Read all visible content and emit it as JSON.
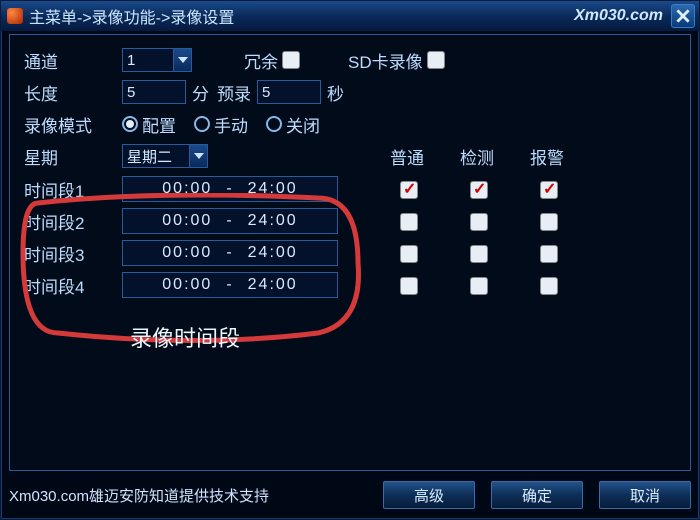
{
  "title": "主菜单->录像功能->录像设置",
  "watermark": "Xm030.com",
  "labels": {
    "channel": "通道",
    "redundancy": "冗余",
    "sdrecord": "SD卡录像",
    "length": "长度",
    "length_unit": "分",
    "prerecord": "预录",
    "prerecord_unit": "秒",
    "mode": "录像模式",
    "mode_config": "配置",
    "mode_manual": "手动",
    "mode_off": "关闭",
    "week": "星期",
    "col_normal": "普通",
    "col_detect": "检测",
    "col_alarm": "报警",
    "period_prefix": "时间段",
    "annotation": "录像时间段"
  },
  "values": {
    "channel": "1",
    "length": "5",
    "prerecord": "5",
    "week": "星期二",
    "redundancy_checked": false,
    "sdrecord_checked": false,
    "mode_selected": "config"
  },
  "periods": [
    {
      "label": "时间段1",
      "start": "00:00",
      "end": "24:00",
      "normal": true,
      "detect": true,
      "alarm": true
    },
    {
      "label": "时间段2",
      "start": "00:00",
      "end": "24:00",
      "normal": false,
      "detect": false,
      "alarm": false
    },
    {
      "label": "时间段3",
      "start": "00:00",
      "end": "24:00",
      "normal": false,
      "detect": false,
      "alarm": false
    },
    {
      "label": "时间段4",
      "start": "00:00",
      "end": "24:00",
      "normal": false,
      "detect": false,
      "alarm": false
    }
  ],
  "footer": {
    "support_text": "Xm030.com雄迈安防知道提供技术支持",
    "btn_advanced": "高级",
    "btn_ok": "确定",
    "btn_cancel": "取消"
  }
}
